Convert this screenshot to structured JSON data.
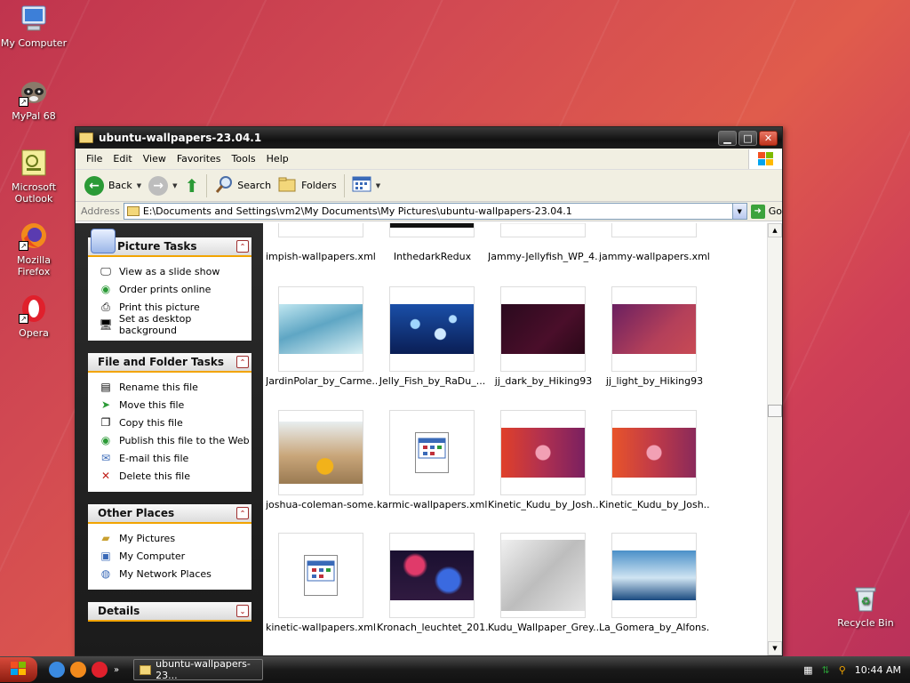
{
  "desktop": {
    "icons": [
      {
        "label": "My Computer"
      },
      {
        "label": "MyPal 68"
      },
      {
        "label": "Microsoft Outlook"
      },
      {
        "label": "Mozilla Firefox"
      },
      {
        "label": "Opera"
      },
      {
        "label": "Recycle Bin"
      }
    ]
  },
  "window": {
    "title": "ubuntu-wallpapers-23.04.1",
    "menu": [
      "File",
      "Edit",
      "View",
      "Favorites",
      "Tools",
      "Help"
    ],
    "toolbar": {
      "back": "Back",
      "search": "Search",
      "folders": "Folders"
    },
    "address": {
      "label": "Address",
      "path": "E:\\Documents and Settings\\vm2\\My Documents\\My Pictures\\ubuntu-wallpapers-23.04.1",
      "go": "Go"
    }
  },
  "tasks": {
    "picture": {
      "title": "Picture Tasks",
      "items": [
        "View as a slide show",
        "Order prints online",
        "Print this picture",
        "Set as desktop background"
      ]
    },
    "file": {
      "title": "File and Folder Tasks",
      "items": [
        "Rename this file",
        "Move this file",
        "Copy this file",
        "Publish this file to the Web",
        "E-mail this file",
        "Delete this file"
      ]
    },
    "places": {
      "title": "Other Places",
      "items": [
        "My Pictures",
        "My Computer",
        "My Network Places"
      ]
    },
    "details": {
      "title": "Details"
    }
  },
  "files": {
    "row0": [
      "impish-wallpapers.xml.in",
      "InthedarkRedux",
      "Jammy-Jellyfish_WP_4...",
      "jammy-wallpapers.xml.in"
    ],
    "row1": [
      "JardinPolar_by_Carme...",
      "Jelly_Fish_by_RaDu_...",
      "jj_dark_by_Hiking93",
      "jj_light_by_Hiking93"
    ],
    "row2": [
      "joshua-coleman-some...",
      "karmic-wallpapers.xml.in",
      "Kinetic_Kudu_by_Josh...",
      "Kinetic_Kudu_by_Josh..."
    ],
    "row3": [
      "kinetic-wallpapers.xml.in",
      "Kronach_leuchtet_201...",
      "Kudu_Wallpaper_Grey...",
      "La_Gomera_by_Alfons..."
    ]
  },
  "taskbar": {
    "task": "ubuntu-wallpapers-23...",
    "clock": "10:44 AM"
  }
}
